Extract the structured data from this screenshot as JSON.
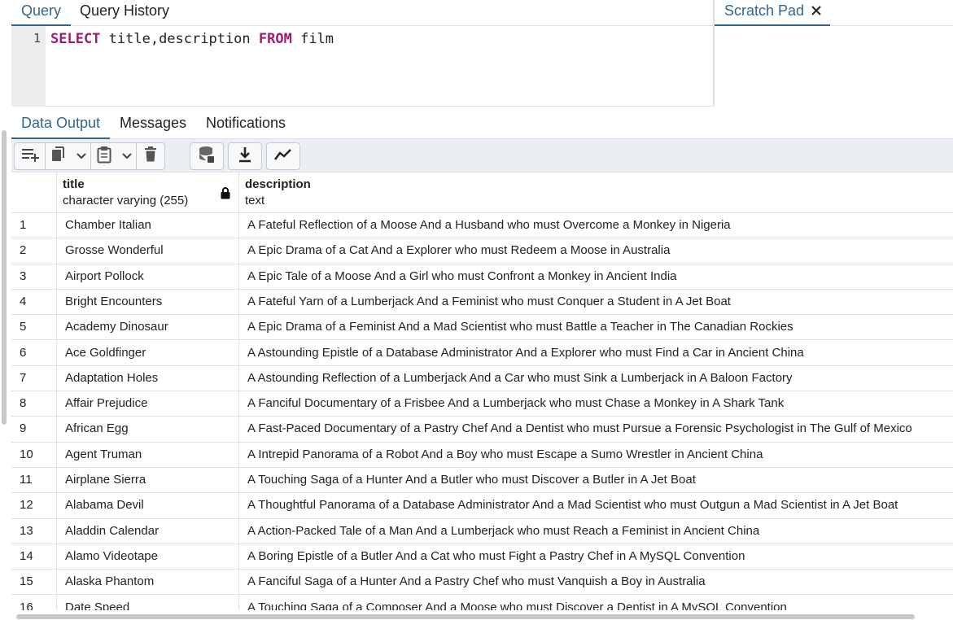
{
  "query_tabs": [
    "Query",
    "Query History"
  ],
  "scratch_pad": {
    "label": "Scratch Pad"
  },
  "editor": {
    "line_number": "1",
    "keyword_select": "SELECT",
    "columns": " title,description ",
    "keyword_from": "FROM",
    "table": " film"
  },
  "output_tabs": [
    "Data Output",
    "Messages",
    "Notifications"
  ],
  "toolbar_icons": [
    "add-row-icon",
    "copy-icon",
    "chevron-down-icon",
    "paste-icon",
    "chevron-down-icon",
    "delete-icon",
    "save-data-icon",
    "download-icon",
    "graph-icon"
  ],
  "columns": [
    {
      "name": "title",
      "type": "character varying (255)",
      "locked": true
    },
    {
      "name": "description",
      "type": "text"
    }
  ],
  "rows": [
    {
      "no": "1",
      "title": "Chamber Italian",
      "description": "A Fateful Reflection of a Moose And a Husband who must Overcome a Monkey in Nigeria"
    },
    {
      "no": "2",
      "title": "Grosse Wonderful",
      "description": "A Epic Drama of a Cat And a Explorer who must Redeem a Moose in Australia"
    },
    {
      "no": "3",
      "title": "Airport Pollock",
      "description": "A Epic Tale of a Moose And a Girl who must Confront a Monkey in Ancient India"
    },
    {
      "no": "4",
      "title": "Bright Encounters",
      "description": "A Fateful Yarn of a Lumberjack And a Feminist who must Conquer a Student in A Jet Boat"
    },
    {
      "no": "5",
      "title": "Academy Dinosaur",
      "description": "A Epic Drama of a Feminist And a Mad Scientist who must Battle a Teacher in The Canadian Rockies"
    },
    {
      "no": "6",
      "title": "Ace Goldfinger",
      "description": "A Astounding Epistle of a Database Administrator And a Explorer who must Find a Car in Ancient China"
    },
    {
      "no": "7",
      "title": "Adaptation Holes",
      "description": "A Astounding Reflection of a Lumberjack And a Car who must Sink a Lumberjack in A Baloon Factory"
    },
    {
      "no": "8",
      "title": "Affair Prejudice",
      "description": "A Fanciful Documentary of a Frisbee And a Lumberjack who must Chase a Monkey in A Shark Tank"
    },
    {
      "no": "9",
      "title": "African Egg",
      "description": "A Fast-Paced Documentary of a Pastry Chef And a Dentist who must Pursue a Forensic Psychologist in The Gulf of Mexico"
    },
    {
      "no": "10",
      "title": "Agent Truman",
      "description": "A Intrepid Panorama of a Robot And a Boy who must Escape a Sumo Wrestler in Ancient China"
    },
    {
      "no": "11",
      "title": "Airplane Sierra",
      "description": "A Touching Saga of a Hunter And a Butler who must Discover a Butler in A Jet Boat"
    },
    {
      "no": "12",
      "title": "Alabama Devil",
      "description": "A Thoughtful Panorama of a Database Administrator And a Mad Scientist who must Outgun a Mad Scientist in A Jet Boat"
    },
    {
      "no": "13",
      "title": "Aladdin Calendar",
      "description": "A Action-Packed Tale of a Man And a Lumberjack who must Reach a Feminist in Ancient China"
    },
    {
      "no": "14",
      "title": "Alamo Videotape",
      "description": "A Boring Epistle of a Butler And a Cat who must Fight a Pastry Chef in A MySQL Convention"
    },
    {
      "no": "15",
      "title": "Alaska Phantom",
      "description": "A Fanciful Saga of a Hunter And a Pastry Chef who must Vanquish a Boy in Australia"
    },
    {
      "no": "16",
      "title": "Date Speed",
      "description": "A Touching Saga of a Composer And a Moose who must Discover a Dentist in A MySQL Convention"
    }
  ]
}
